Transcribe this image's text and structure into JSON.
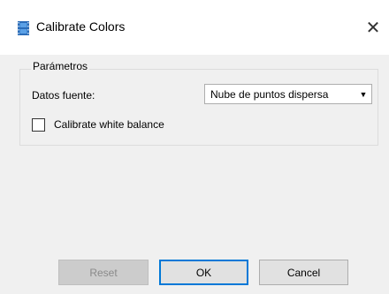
{
  "window": {
    "title": "Calibrate Colors",
    "icon": "film-strip-icon",
    "close_glyph": "✕"
  },
  "params": {
    "group_title": "Parámetros",
    "source_label": "Datos fuente:",
    "source_value": "Nube de puntos dispersa",
    "calibrate_wb_label": "Calibrate white balance",
    "calibrate_wb_checked": false
  },
  "buttons": {
    "reset": "Reset",
    "ok": "OK",
    "cancel": "Cancel"
  },
  "colors": {
    "accent": "#0078d7",
    "client_bg": "#f0f0f0"
  }
}
